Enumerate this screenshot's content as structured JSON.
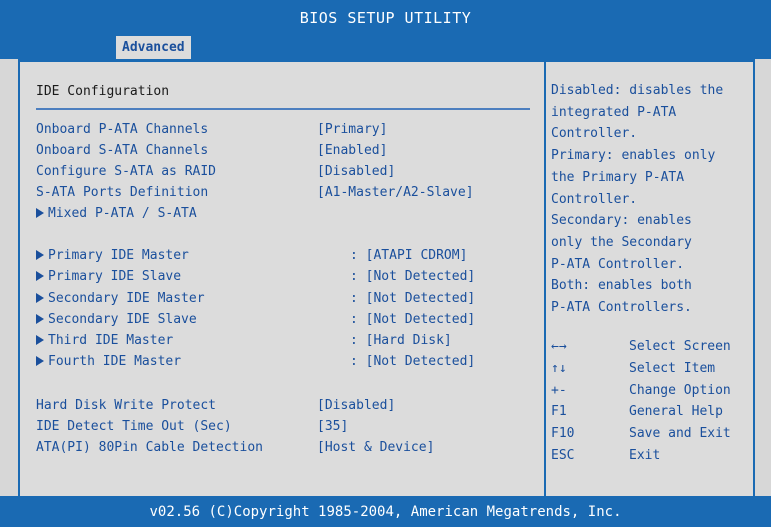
{
  "title": "BIOS SETUP UTILITY",
  "tab": "Advanced",
  "section_title": "IDE Configuration",
  "settings_group1": [
    {
      "label": "Onboard P-ATA Channels",
      "value": "[Primary]"
    },
    {
      "label": "Onboard S-ATA Channels",
      "value": "[Enabled]"
    },
    {
      "label": "Configure S-ATA as RAID",
      "value": "[Disabled]"
    },
    {
      "label": "S-ATA Ports Definition",
      "value": "[A1-Master/A2-Slave]"
    }
  ],
  "submenu_mixed": "Mixed P-ATA / S-ATA",
  "ide_devices": [
    {
      "label": "Primary IDE Master",
      "value": ": [ATAPI CDROM]"
    },
    {
      "label": "Primary IDE Slave",
      "value": ": [Not Detected]"
    },
    {
      "label": "Secondary IDE Master",
      "value": ": [Not Detected]"
    },
    {
      "label": "Secondary IDE Slave",
      "value": ": [Not Detected]"
    },
    {
      "label": "Third IDE Master",
      "value": ": [Hard Disk]"
    },
    {
      "label": "Fourth IDE Master",
      "value": ": [Not Detected]"
    }
  ],
  "settings_group2": [
    {
      "label": "Hard Disk Write Protect",
      "value": "[Disabled]"
    },
    {
      "label": "IDE Detect Time Out (Sec)",
      "value": "[35]"
    },
    {
      "label": "ATA(PI) 80Pin Cable Detection",
      "value": "[Host & Device]"
    }
  ],
  "help_lines": [
    "Disabled: disables the",
    "integrated P-ATA",
    "Controller.",
    "Primary: enables only",
    "the Primary P-ATA",
    "Controller.",
    "Secondary: enables",
    "only the Secondary",
    "P-ATA Controller.",
    "Both: enables both",
    "P-ATA Controllers."
  ],
  "keys": [
    {
      "key": "←→",
      "desc": "Select Screen"
    },
    {
      "key": "↑↓",
      "desc": "Select Item"
    },
    {
      "key": "+-",
      "desc": "Change Option"
    },
    {
      "key": "F1",
      "desc": "General Help"
    },
    {
      "key": "F10",
      "desc": "Save and Exit"
    },
    {
      "key": "ESC",
      "desc": "Exit"
    }
  ],
  "footer": "v02.56 (C)Copyright 1985-2004, American Megatrends, Inc.",
  "colors": {
    "frame_blue": "#1a6ab3",
    "text_blue": "#1a4f9c",
    "panel_gray": "#dcdcdc"
  }
}
